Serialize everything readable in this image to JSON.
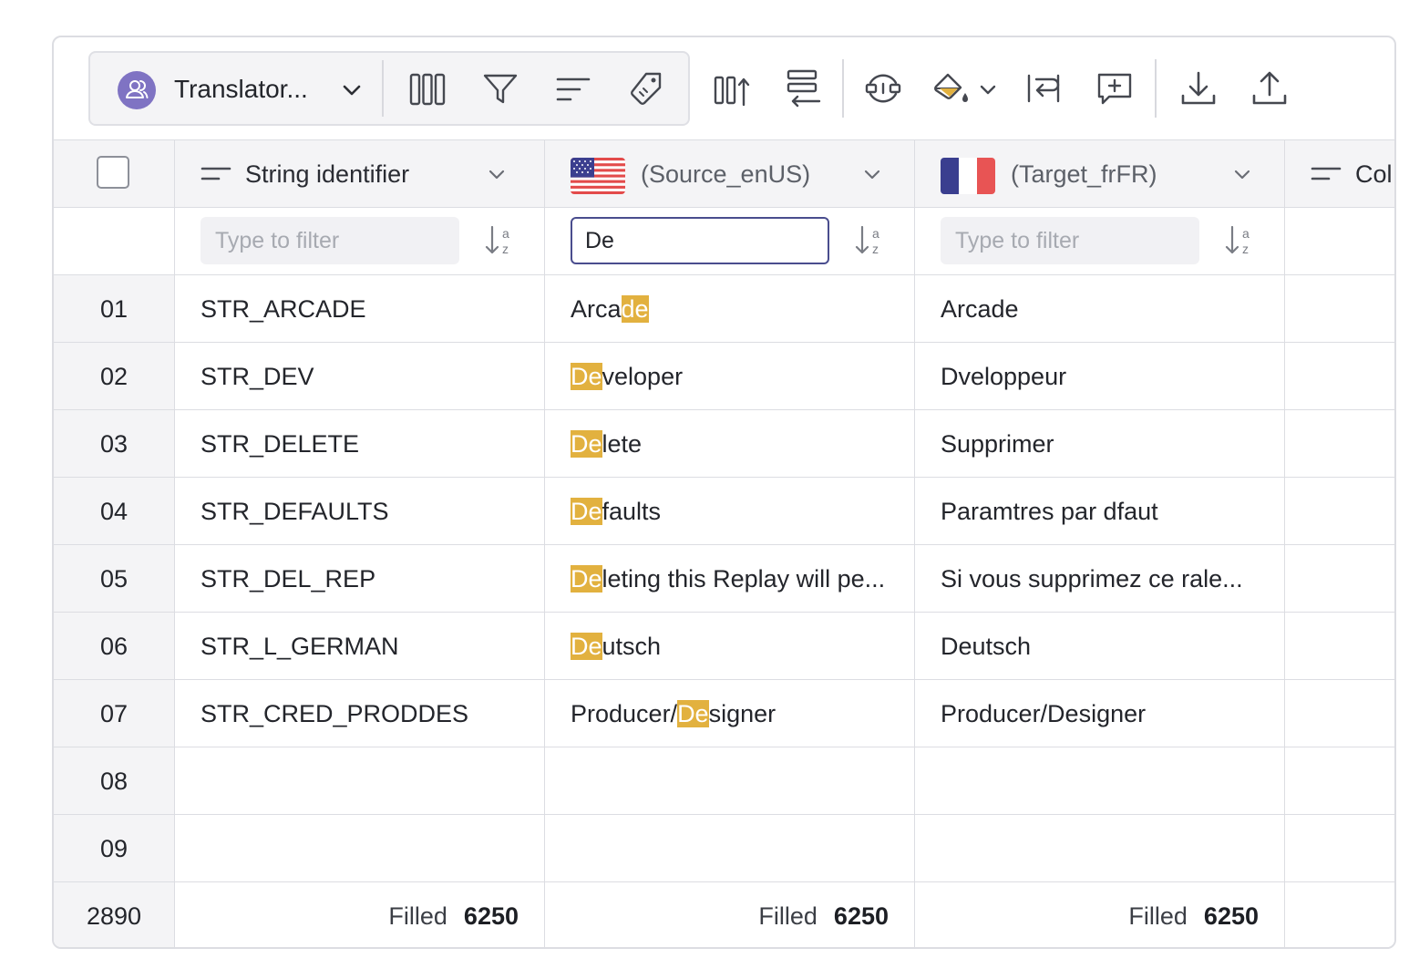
{
  "toolbar": {
    "view_name": "Translator...",
    "icons": [
      "columns-icon",
      "filter-icon",
      "sort-icon",
      "tag-icon",
      "insert-column-icon",
      "insert-row-icon",
      "view-toggle-icon",
      "paint-bucket-icon",
      "wrap-text-icon",
      "add-comment-icon",
      "download-icon",
      "upload-icon"
    ]
  },
  "columns": [
    {
      "title": "String identifier",
      "filter_value": "",
      "filter_placeholder": "Type to filter"
    },
    {
      "title": "(Source_enUS)",
      "filter_value": "De",
      "filter_placeholder": "Type to filter"
    },
    {
      "title": "(Target_frFR)",
      "filter_value": "",
      "filter_placeholder": "Type to filter"
    },
    {
      "title": "Col"
    }
  ],
  "highlight_color": "#e2b13f",
  "rows": [
    {
      "idx": "01",
      "id": "STR_ARCADE",
      "src_pre": "Arca",
      "src_hl": "de",
      "src_post": "",
      "tgt": "Arcade"
    },
    {
      "idx": "02",
      "id": "STR_DEV",
      "src_pre": "",
      "src_hl": "De",
      "src_post": "veloper",
      "tgt": "Dveloppeur"
    },
    {
      "idx": "03",
      "id": "STR_DELETE",
      "src_pre": "",
      "src_hl": "De",
      "src_post": "lete",
      "tgt": "Supprimer"
    },
    {
      "idx": "04",
      "id": "STR_DEFAULTS",
      "src_pre": "",
      "src_hl": "De",
      "src_post": "faults",
      "tgt": "Paramtres par dfaut"
    },
    {
      "idx": "05",
      "id": "STR_DEL_REP",
      "src_pre": "",
      "src_hl": "De",
      "src_post": "leting this Replay will pe...",
      "tgt": "Si vous supprimez ce rale..."
    },
    {
      "idx": "06",
      "id": "STR_L_GERMAN",
      "src_pre": "",
      "src_hl": "De",
      "src_post": "utsch",
      "tgt": "Deutsch"
    },
    {
      "idx": "07",
      "id": "STR_CRED_PRODDES",
      "src_pre": "Producer/",
      "src_hl": "De",
      "src_post": "signer",
      "tgt": "Producer/Designer"
    },
    {
      "idx": "08",
      "id": "",
      "src_pre": "",
      "src_hl": "",
      "src_post": "",
      "tgt": ""
    },
    {
      "idx": "09",
      "id": "",
      "src_pre": "",
      "src_hl": "",
      "src_post": "",
      "tgt": ""
    }
  ],
  "footer": {
    "total": "2890",
    "label": "Filled",
    "counts": [
      "6250",
      "6250",
      "6250"
    ]
  }
}
